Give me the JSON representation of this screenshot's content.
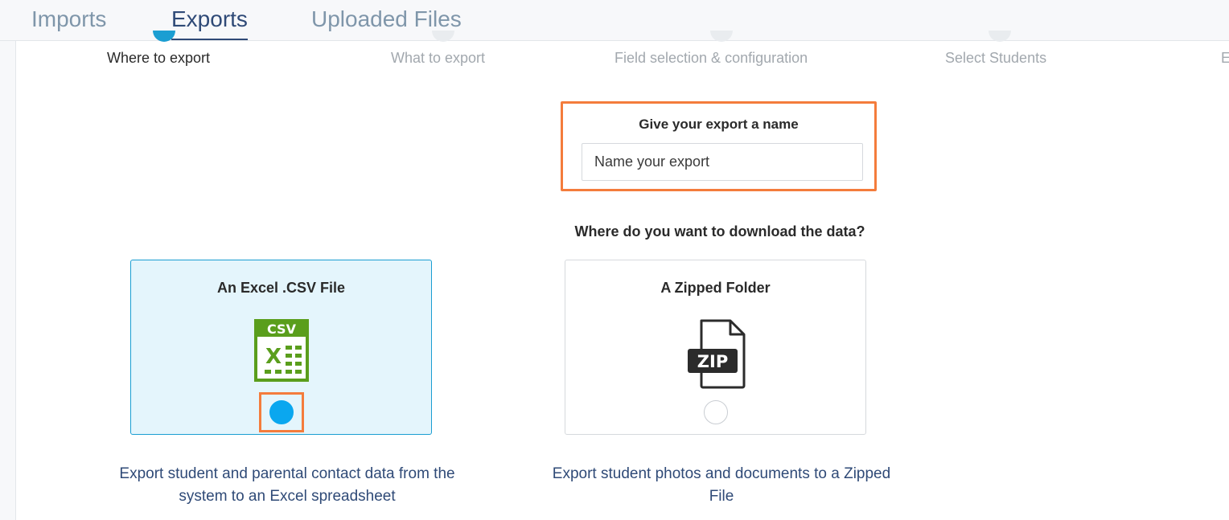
{
  "tabs": [
    {
      "label": "Imports",
      "active": false
    },
    {
      "label": "Exports",
      "active": true
    },
    {
      "label": "Uploaded Files",
      "active": false
    }
  ],
  "steps": [
    {
      "label": "Where to export",
      "active": true
    },
    {
      "label": "What to export",
      "active": false
    },
    {
      "label": "Field selection & configuration",
      "active": false
    },
    {
      "label": "Select Students",
      "active": false
    },
    {
      "label": "E",
      "active": false
    }
  ],
  "export_name": {
    "title": "Give your export a name",
    "placeholder": "Name your export",
    "value": ""
  },
  "question": "Where do you want to download the data?",
  "options": [
    {
      "title": "An Excel .CSV File",
      "icon": "csv-file-icon",
      "icon_text": "CSV",
      "selected": true,
      "description_line1": "Export student and parental contact data from the",
      "description_line2": "system to an Excel spreadsheet"
    },
    {
      "title": "A Zipped Folder",
      "icon": "zip-file-icon",
      "icon_text": "ZIP",
      "selected": false,
      "description_line1": "Export student photos and documents to a Zipped",
      "description_line2": "File"
    }
  ],
  "colors": {
    "accent": "#0aa7ef",
    "highlight": "#f47c3c",
    "tab_active": "#2f4a77",
    "csv_green": "#5a9e1c"
  }
}
